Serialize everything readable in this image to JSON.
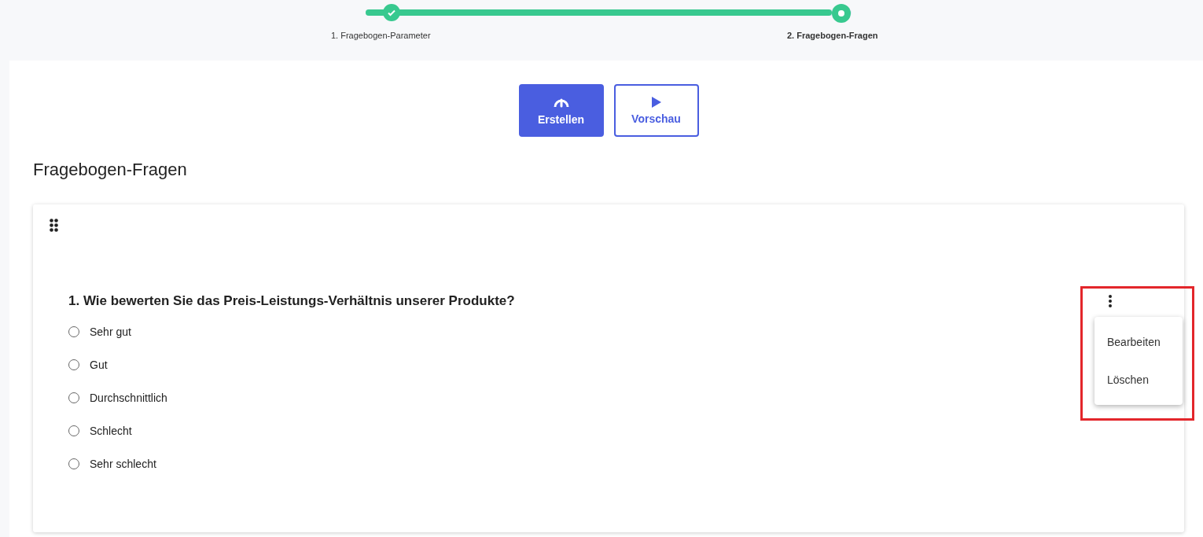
{
  "stepper": {
    "level": 0.96,
    "steps": [
      {
        "label": "1. Fragebogen-Parameter",
        "completed": true,
        "selected": false
      },
      {
        "label": "2. Fragebogen-Fragen",
        "completed": false,
        "selected": true
      }
    ]
  },
  "toolbar": {
    "buttons": [
      {
        "label": "Erstellen",
        "kind": "primary"
      },
      {
        "label": "Vorschau",
        "kind": "outline"
      }
    ]
  },
  "section_title": "Fragebogen-Fragen",
  "question": {
    "text": "1. Wie bewerten Sie das Preis-Leistungs-Verhältnis unserer Produkte?",
    "options": [
      {
        "label": "Sehr gut",
        "selected": false
      },
      {
        "label": "Gut",
        "selected": false
      },
      {
        "label": "Durchschnittlich",
        "selected": false
      },
      {
        "label": "Schlecht",
        "selected": false
      },
      {
        "label": "Sehr schlecht",
        "selected": false
      }
    ],
    "menu": {
      "open": true,
      "items": [
        "Bearbeiten",
        "Löschen"
      ]
    }
  },
  "annotation": {
    "kind": "highlight-frame",
    "color": "#e3262b"
  }
}
